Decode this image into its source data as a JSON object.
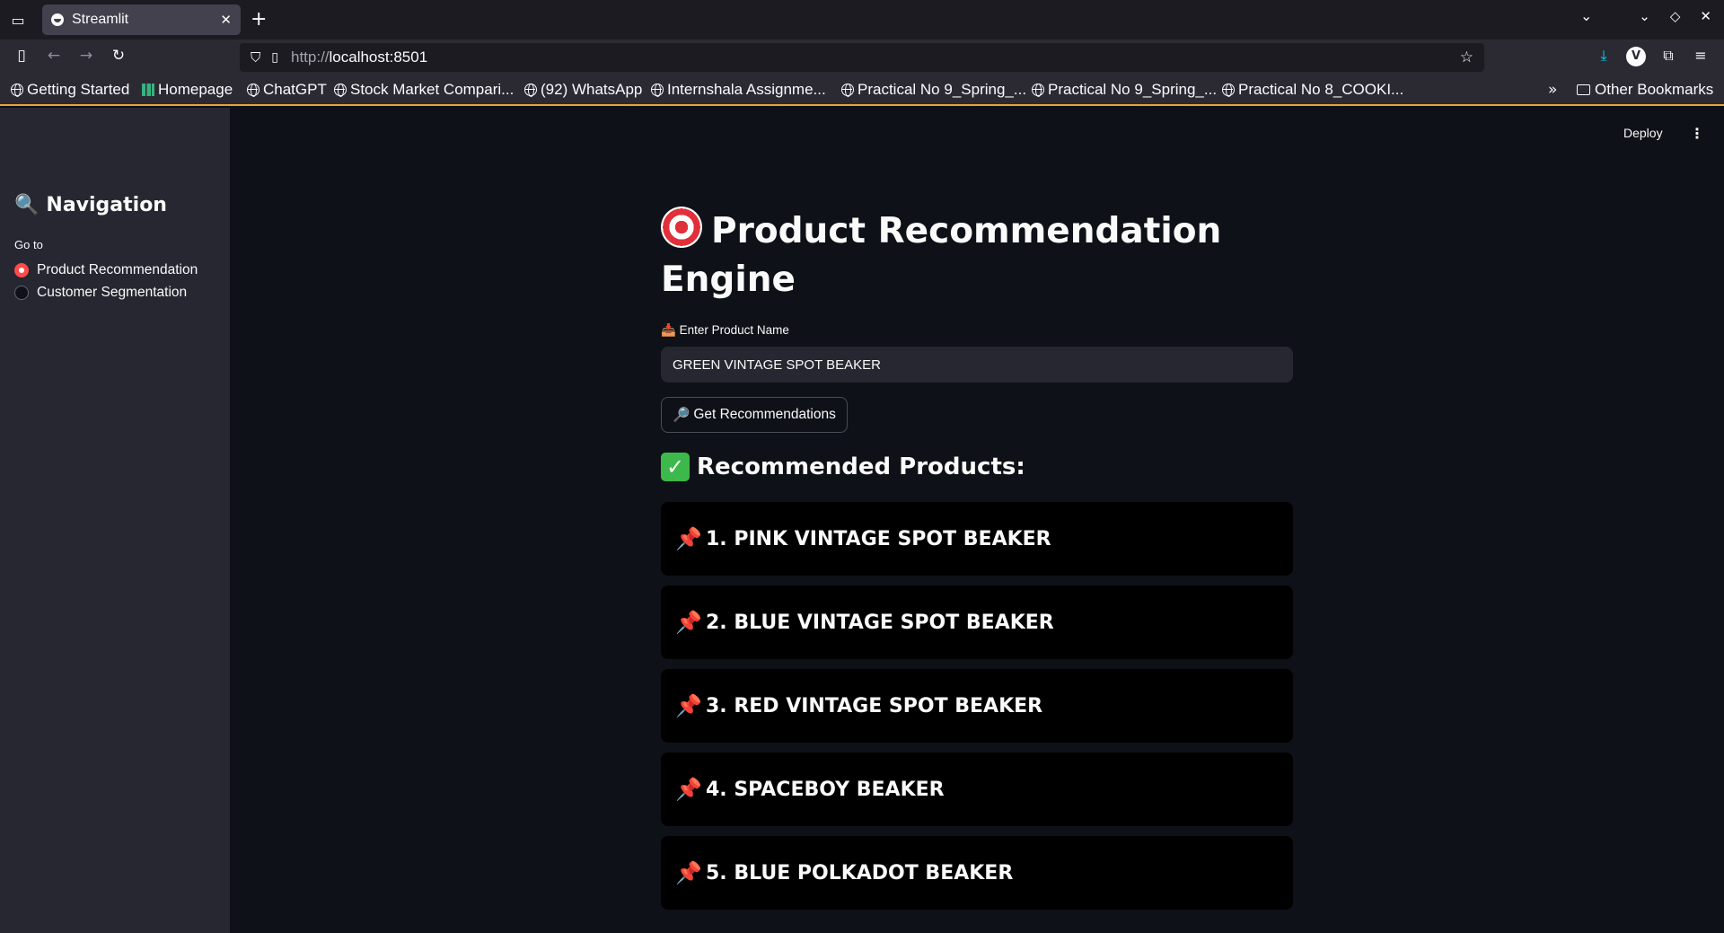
{
  "browser": {
    "tab_title": "Streamlit",
    "new_tab": "+",
    "url_prefix": "http://",
    "url_host": "localhost:8501",
    "bookmarks": [
      "Getting Started",
      "Homepage",
      "ChatGPT",
      "Stock Market Compari...",
      "(92) WhatsApp",
      "Internshala Assignme...",
      "Practical No 9_Spring_...",
      "Practical No 9_Spring_...",
      "Practical No 8_COOKI..."
    ],
    "other_bookmarks": "Other Bookmarks"
  },
  "app": {
    "deploy_label": "Deploy",
    "sidebar": {
      "title": "Navigation",
      "title_icon": "🔍",
      "radio_label": "Go to",
      "options": [
        {
          "label": "Product Recommendation",
          "selected": true
        },
        {
          "label": "Customer Segmentation",
          "selected": false
        }
      ]
    },
    "main": {
      "title": "Product Recommendation Engine",
      "input_label": "Enter Product Name",
      "input_icon": "📥",
      "input_value": "GREEN VINTAGE SPOT BEAKER",
      "button_icon": "🔎",
      "button_label": "Get Recommendations",
      "results_heading": "Recommended Products:",
      "recommendations": [
        "1. PINK VINTAGE SPOT BEAKER",
        "2. BLUE VINTAGE SPOT BEAKER",
        "3. RED VINTAGE SPOT BEAKER",
        "4. SPACEBOY BEAKER",
        "5. BLUE POLKADOT BEAKER"
      ]
    }
  },
  "colors": {
    "accent": "#ff4b4b",
    "background": "#0e1117",
    "sidebar": "#262730",
    "card": "#000000"
  }
}
